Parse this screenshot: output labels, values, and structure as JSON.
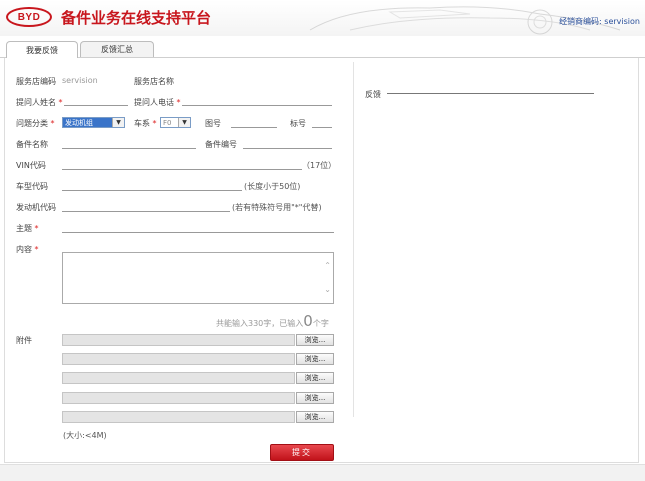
{
  "header": {
    "logo_text": "BYD",
    "title": "备件业务在线支持平台",
    "dealer_label": "经销商编码: servision",
    "brand_color": "#c8161d"
  },
  "tabs": [
    {
      "label": "我要反馈",
      "active": true
    },
    {
      "label": "反馈汇总",
      "active": false
    }
  ],
  "form": {
    "store_code_label": "服务店编码",
    "store_code_value": "servision",
    "store_name_label": "服务店名称",
    "asker_name_label": "提问人姓名",
    "asker_phone_label": "提问人电话",
    "category_label": "问题分类",
    "category_value": "发动机组",
    "series_label": "车系",
    "series_value": "F0",
    "drawing_label": "图号",
    "mark_label": "标号",
    "part_name_label": "备件名称",
    "part_no_label": "备件编号",
    "vin_label": "VIN代码",
    "vin_hint": "（17位）",
    "model_label": "车型代码",
    "model_hint": "(长度小于50位)",
    "engine_label": "发动机代码",
    "engine_hint": "(若有特殊符号用\"*\"代替)",
    "subject_label": "主题",
    "content_label": "内容",
    "counter_prefix": "共能输入330字，已输入",
    "counter_value": "0",
    "counter_suffix": "个字",
    "attachment_label": "附件",
    "browse_label": "浏览...",
    "size_hint": "(大小:<4M)",
    "submit_label": "提交",
    "required_mark": "*"
  },
  "feedback": {
    "label": "反馈"
  }
}
